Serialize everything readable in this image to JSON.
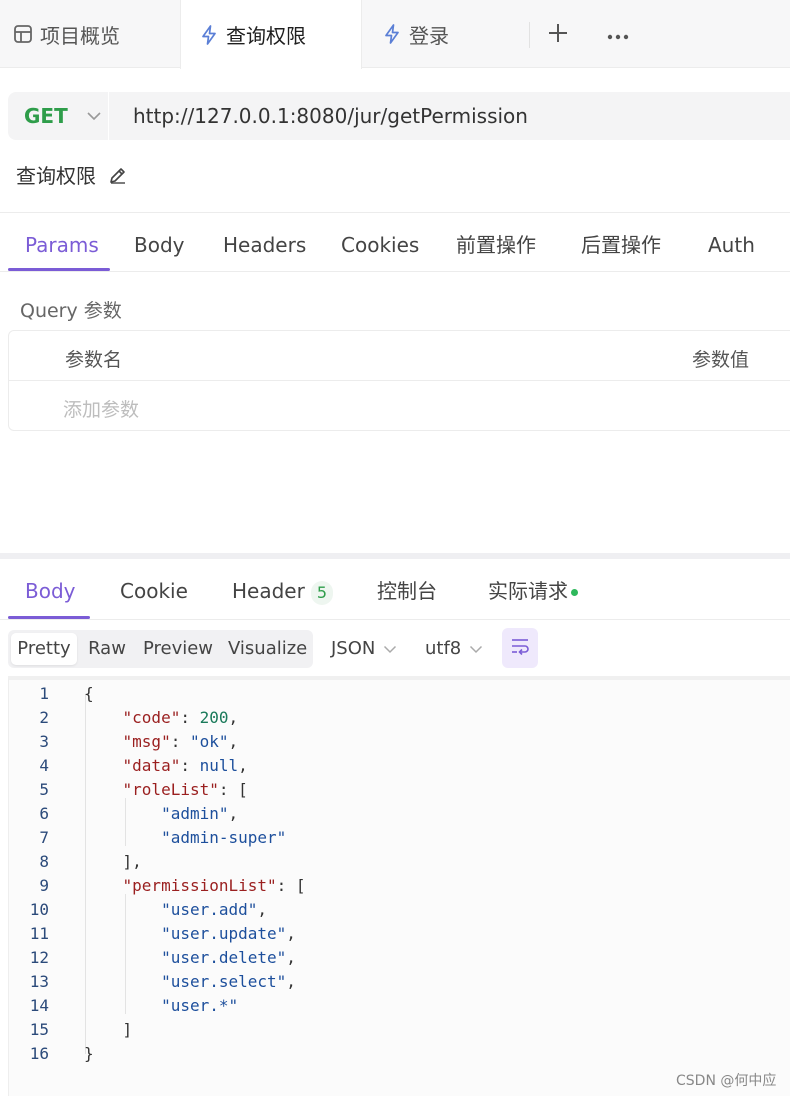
{
  "tabs": [
    {
      "label": "项目概览",
      "icon": "layout-icon"
    },
    {
      "label": "查询权限",
      "icon": "bolt-icon",
      "active": true
    },
    {
      "label": "登录",
      "icon": "bolt-icon"
    }
  ],
  "request": {
    "method": "GET",
    "url": "http://127.0.0.1:8080/jur/getPermission",
    "name": "查询权限"
  },
  "request_tabs": [
    "Params",
    "Body",
    "Headers",
    "Cookies",
    "前置操作",
    "后置操作",
    "Auth"
  ],
  "params": {
    "section_label": "Query 参数",
    "col_name": "参数名",
    "col_value": "参数值",
    "add_placeholder": "添加参数"
  },
  "response_tabs": [
    {
      "label": "Body",
      "active": true
    },
    {
      "label": "Cookie"
    },
    {
      "label": "Header",
      "badge": "5"
    },
    {
      "label": "控制台"
    },
    {
      "label": "实际请求",
      "dot": true
    }
  ],
  "view_modes": [
    "Pretty",
    "Raw",
    "Preview",
    "Visualize"
  ],
  "format": "JSON",
  "encoding": "utf8",
  "code_lines": [
    {
      "n": "1",
      "text": "{"
    },
    {
      "n": "2",
      "key": "\"code\"",
      "value": "200",
      "vtype": "num",
      "trail": ","
    },
    {
      "n": "3",
      "key": "\"msg\"",
      "value": "\"ok\"",
      "vtype": "str",
      "trail": ","
    },
    {
      "n": "4",
      "key": "\"data\"",
      "value": "null",
      "vtype": "kw",
      "trail": ","
    },
    {
      "n": "5",
      "key": "\"roleList\"",
      "value": "[",
      "vtype": "plain",
      "trail": ""
    },
    {
      "n": "6",
      "item": "\"admin\"",
      "trail": ","
    },
    {
      "n": "7",
      "item": "\"admin-super\"",
      "trail": ""
    },
    {
      "n": "8",
      "text": "    ],"
    },
    {
      "n": "9",
      "key": "\"permissionList\"",
      "value": "[",
      "vtype": "plain",
      "trail": ""
    },
    {
      "n": "10",
      "item": "\"user.add\"",
      "trail": ","
    },
    {
      "n": "11",
      "item": "\"user.update\"",
      "trail": ","
    },
    {
      "n": "12",
      "item": "\"user.delete\"",
      "trail": ","
    },
    {
      "n": "13",
      "item": "\"user.select\"",
      "trail": ","
    },
    {
      "n": "14",
      "item": "\"user.*\"",
      "trail": ""
    },
    {
      "n": "15",
      "text": "    ]"
    },
    {
      "n": "16",
      "text": "}"
    }
  ],
  "watermark": "CSDN @何中应",
  "colors": {
    "accent": "#7b5cd6",
    "method": "#2e9d4a"
  }
}
